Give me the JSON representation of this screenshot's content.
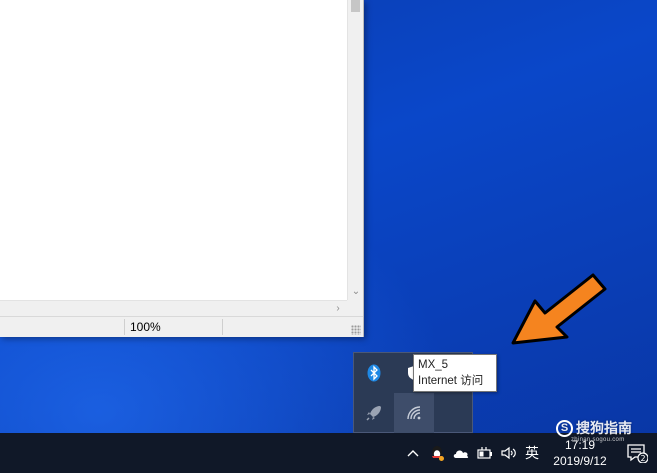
{
  "notepad": {
    "status_zoom": "100%"
  },
  "tooltip": {
    "network_name": "MX_5",
    "network_status": "Internet 访问"
  },
  "tray_flyout": {
    "icons": [
      "bluetooth-icon",
      "shield-icon",
      "rocket-icon",
      "wifi-icon"
    ]
  },
  "taskbar": {
    "ime_label": "英",
    "time": "17:19",
    "date": "2019/9/12",
    "notification_count": "2"
  },
  "watermark": {
    "brand": "搜狗指南",
    "brand_mark": "S",
    "url": "zhinan.sogou.com"
  },
  "colors": {
    "desktop": "#0a3fb8",
    "taskbar": "#101828",
    "arrow": "#f5841f"
  }
}
